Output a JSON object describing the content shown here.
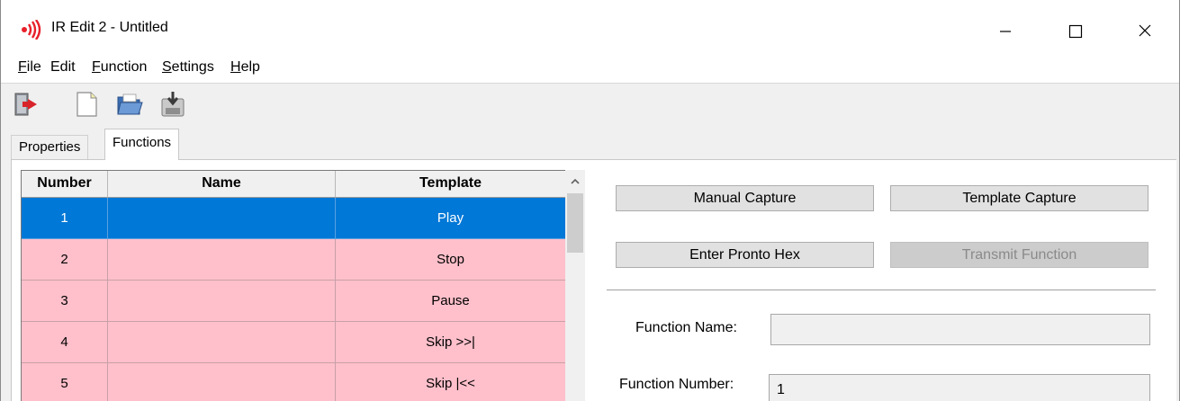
{
  "window": {
    "title": "IR Edit 2 - Untitled",
    "controls": {
      "minimize": "minimize",
      "maximize": "maximize",
      "close": "close"
    }
  },
  "menu": {
    "items": [
      {
        "accel": "F",
        "rest": "ile"
      },
      {
        "accel": "",
        "rest": "Edit"
      },
      {
        "accel": "F",
        "rest": "unction"
      },
      {
        "accel": "S",
        "rest": "ettings"
      },
      {
        "accel": "H",
        "rest": "elp"
      }
    ]
  },
  "toolbar": {
    "icons": [
      "exit-icon",
      "new-file-icon",
      "open-folder-icon",
      "save-icon"
    ]
  },
  "tabs": [
    {
      "label": "Properties",
      "active": false
    },
    {
      "label": "Functions",
      "active": true
    }
  ],
  "grid": {
    "columns": [
      "Number",
      "Name",
      "Template"
    ],
    "rows": [
      {
        "number": "1",
        "name": "",
        "template": "Play",
        "selected": true
      },
      {
        "number": "2",
        "name": "",
        "template": "Stop",
        "selected": false
      },
      {
        "number": "3",
        "name": "",
        "template": "Pause",
        "selected": false
      },
      {
        "number": "4",
        "name": "",
        "template": "Skip >>|",
        "selected": false
      },
      {
        "number": "5",
        "name": "",
        "template": "Skip |<<",
        "selected": false
      }
    ]
  },
  "buttons": {
    "manual_capture": "Manual Capture",
    "template_capture": "Template Capture",
    "enter_pronto_hex": "Enter Pronto Hex",
    "transmit_function": "Transmit Function"
  },
  "fields": {
    "function_name_label": "Function Name:",
    "function_name_value": "",
    "function_number_label": "Function Number:",
    "function_number_value": "1"
  },
  "colors": {
    "selected_row": "#0078d7",
    "row_highlight": "#ffc0cb",
    "app_icon": "#e8202a"
  }
}
